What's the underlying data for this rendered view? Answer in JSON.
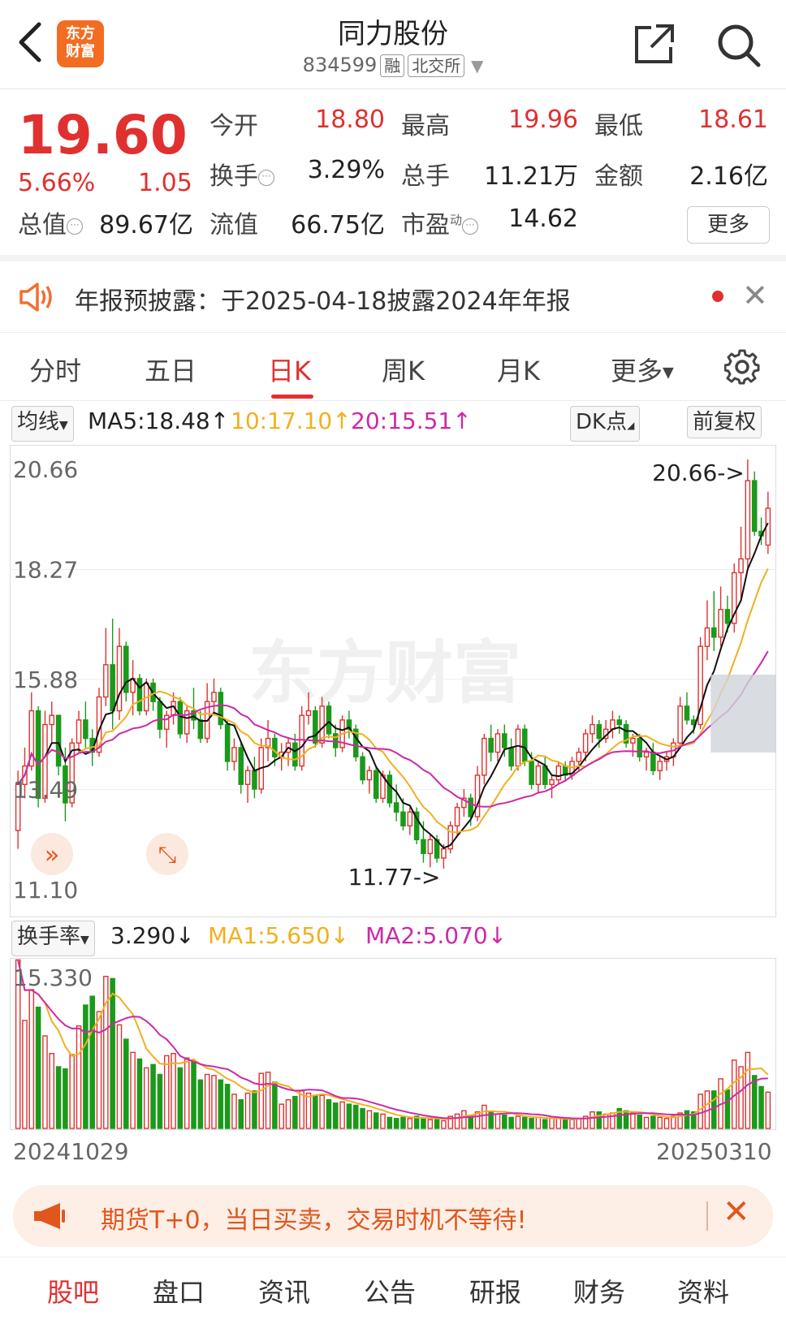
{
  "header": {
    "logo_line1": "东方",
    "logo_line2": "财富",
    "title": "同力股份",
    "code": "834599",
    "tag_margin": "融",
    "tag_exchange": "北交所"
  },
  "quote": {
    "price": "19.60",
    "pct": "5.66%",
    "change": "1.05",
    "stats": [
      {
        "label": "今开",
        "value": "18.80",
        "color": "#e03030"
      },
      {
        "label": "最高",
        "value": "19.96",
        "color": "#e03030"
      },
      {
        "label": "最低",
        "value": "18.61",
        "color": "#e03030"
      },
      {
        "label": "换手",
        "value": "3.29%",
        "color": "#222222"
      },
      {
        "label": "总手",
        "value": "11.21万",
        "color": "#222222"
      },
      {
        "label": "金额",
        "value": "2.16亿",
        "color": "#222222"
      },
      {
        "label": "总值",
        "value": "89.67亿",
        "color": "#222222"
      },
      {
        "label": "流值",
        "value": "66.75亿",
        "color": "#222222"
      },
      {
        "label": "市盈",
        "value": "14.62",
        "color": "#222222"
      }
    ],
    "pe_superscript": "动",
    "more_button": "更多"
  },
  "notice": {
    "text": "年报预披露：于2025-04-18披露2024年年报"
  },
  "tabs": [
    "分时",
    "五日",
    "日K",
    "周K",
    "月K",
    "更多"
  ],
  "active_tab": "日K",
  "ma_bar": {
    "selector": "均线",
    "ma5": "MA5:18.48",
    "ma10": "10:17.10",
    "ma20": "20:15.51",
    "dk": "DK点",
    "adjust": "前复权"
  },
  "chart_data": {
    "type": "candlestick",
    "ylim": [
      11.1,
      20.66
    ],
    "y_ticks": [
      "20.66",
      "18.27",
      "15.88",
      "13.49",
      "11.10"
    ],
    "annotations": {
      "high": "20.66->",
      "low": "11.77->"
    },
    "watermark": "东方财富",
    "x_start": "20241029",
    "x_end": "20250310",
    "candles": [
      [
        12.6,
        13.9,
        12.2,
        13.6
      ],
      [
        13.6,
        14.4,
        13.3,
        14.0
      ],
      [
        14.0,
        15.6,
        13.9,
        15.2
      ],
      [
        15.2,
        15.3,
        13.1,
        13.3
      ],
      [
        13.3,
        15.2,
        13.2,
        14.9
      ],
      [
        14.9,
        15.4,
        14.5,
        15.1
      ],
      [
        15.1,
        15.1,
        13.8,
        14.0
      ],
      [
        14.0,
        14.4,
        12.8,
        13.2
      ],
      [
        13.2,
        14.6,
        13.1,
        14.5
      ],
      [
        14.5,
        15.2,
        14.3,
        15.0
      ],
      [
        15.0,
        15.4,
        14.4,
        14.6
      ],
      [
        14.6,
        14.8,
        14.0,
        14.3
      ],
      [
        14.3,
        15.7,
        14.2,
        15.5
      ],
      [
        15.5,
        17.0,
        15.3,
        16.2
      ],
      [
        16.2,
        17.2,
        14.8,
        15.2
      ],
      [
        15.2,
        17.0,
        15.0,
        16.6
      ],
      [
        16.6,
        16.7,
        15.4,
        15.6
      ],
      [
        15.6,
        16.3,
        15.1,
        15.9
      ],
      [
        15.9,
        16.0,
        15.1,
        15.2
      ],
      [
        15.2,
        15.9,
        15.1,
        15.8
      ],
      [
        15.8,
        15.9,
        15.2,
        15.4
      ],
      [
        15.4,
        15.5,
        14.6,
        14.8
      ],
      [
        14.8,
        15.2,
        14.4,
        15.1
      ],
      [
        15.1,
        15.6,
        14.9,
        15.4
      ],
      [
        15.4,
        15.5,
        14.6,
        14.7
      ],
      [
        14.7,
        15.3,
        14.5,
        15.2
      ],
      [
        15.2,
        15.7,
        14.8,
        15.0
      ],
      [
        15.0,
        15.2,
        14.5,
        14.6
      ],
      [
        14.6,
        15.8,
        14.5,
        15.4
      ],
      [
        15.4,
        15.9,
        15.1,
        15.6
      ],
      [
        15.6,
        15.7,
        14.8,
        14.9
      ],
      [
        14.9,
        15.0,
        13.9,
        14.1
      ],
      [
        14.1,
        14.6,
        13.9,
        14.4
      ],
      [
        14.4,
        14.5,
        13.4,
        13.6
      ],
      [
        13.6,
        14.0,
        13.2,
        13.9
      ],
      [
        13.9,
        14.2,
        13.3,
        13.5
      ],
      [
        13.5,
        14.6,
        13.4,
        14.4
      ],
      [
        14.4,
        15.0,
        14.1,
        14.6
      ],
      [
        14.6,
        14.7,
        14.0,
        14.2
      ],
      [
        14.2,
        14.5,
        13.9,
        14.3
      ],
      [
        14.3,
        14.6,
        14.0,
        14.5
      ],
      [
        14.5,
        14.7,
        13.9,
        14.0
      ],
      [
        14.0,
        15.3,
        13.9,
        15.1
      ],
      [
        15.1,
        15.6,
        14.9,
        15.2
      ],
      [
        15.2,
        15.3,
        14.4,
        14.5
      ],
      [
        14.5,
        15.5,
        14.4,
        15.3
      ],
      [
        15.3,
        15.4,
        14.6,
        14.7
      ],
      [
        14.7,
        14.9,
        14.2,
        14.4
      ],
      [
        14.4,
        15.1,
        14.3,
        15.0
      ],
      [
        15.0,
        15.2,
        14.6,
        14.8
      ],
      [
        14.8,
        14.9,
        14.1,
        14.2
      ],
      [
        14.2,
        14.3,
        13.6,
        13.7
      ],
      [
        13.7,
        14.0,
        13.4,
        13.9
      ],
      [
        13.9,
        14.0,
        13.2,
        13.3
      ],
      [
        13.3,
        13.9,
        13.2,
        13.8
      ],
      [
        13.8,
        13.9,
        13.1,
        13.2
      ],
      [
        13.2,
        13.6,
        12.8,
        13.0
      ],
      [
        13.0,
        13.3,
        12.6,
        12.7
      ],
      [
        12.7,
        13.1,
        12.5,
        13.0
      ],
      [
        13.0,
        13.1,
        12.3,
        12.4
      ],
      [
        12.4,
        12.8,
        11.9,
        12.1
      ],
      [
        12.1,
        12.5,
        11.8,
        12.4
      ],
      [
        12.4,
        12.5,
        11.9,
        12.0
      ],
      [
        12.0,
        12.3,
        11.77,
        12.2
      ],
      [
        12.2,
        12.8,
        12.1,
        12.7
      ],
      [
        12.7,
        13.2,
        12.5,
        13.1
      ],
      [
        13.1,
        13.5,
        12.9,
        13.3
      ],
      [
        13.3,
        13.4,
        12.7,
        12.9
      ],
      [
        12.9,
        14.0,
        12.8,
        13.8
      ],
      [
        13.8,
        14.7,
        13.6,
        14.6
      ],
      [
        14.6,
        14.9,
        14.1,
        14.3
      ],
      [
        14.3,
        14.8,
        14.1,
        14.7
      ],
      [
        14.7,
        14.9,
        14.2,
        14.4
      ],
      [
        14.4,
        14.6,
        13.9,
        14.0
      ],
      [
        14.0,
        14.9,
        13.9,
        14.8
      ],
      [
        14.8,
        14.9,
        14.0,
        14.1
      ],
      [
        14.1,
        14.3,
        13.5,
        13.6
      ],
      [
        13.6,
        14.1,
        13.4,
        14.0
      ],
      [
        14.0,
        14.2,
        13.5,
        13.6
      ],
      [
        13.6,
        13.8,
        13.3,
        13.7
      ],
      [
        13.7,
        14.1,
        13.6,
        14.0
      ],
      [
        14.0,
        14.1,
        13.7,
        13.8
      ],
      [
        13.8,
        14.2,
        13.7,
        14.1
      ],
      [
        14.1,
        14.4,
        13.9,
        14.3
      ],
      [
        14.3,
        14.8,
        14.1,
        14.7
      ],
      [
        14.7,
        15.1,
        14.5,
        14.9
      ],
      [
        14.9,
        15.0,
        14.4,
        14.6
      ],
      [
        14.6,
        15.0,
        14.5,
        14.8
      ],
      [
        14.8,
        15.2,
        14.6,
        15.0
      ],
      [
        15.0,
        15.1,
        14.7,
        14.9
      ],
      [
        14.9,
        15.0,
        14.4,
        14.5
      ],
      [
        14.5,
        14.7,
        14.2,
        14.6
      ],
      [
        14.6,
        14.7,
        14.1,
        14.2
      ],
      [
        14.2,
        14.4,
        13.9,
        14.3
      ],
      [
        14.3,
        14.5,
        13.8,
        13.9
      ],
      [
        13.9,
        14.2,
        13.7,
        14.1
      ],
      [
        14.1,
        14.3,
        13.9,
        14.2
      ],
      [
        14.2,
        14.6,
        14.0,
        14.5
      ],
      [
        14.5,
        15.5,
        14.4,
        15.3
      ],
      [
        15.3,
        15.6,
        14.9,
        15.0
      ],
      [
        15.0,
        15.1,
        14.7,
        14.9
      ],
      [
        14.9,
        16.8,
        14.8,
        16.6
      ],
      [
        16.6,
        17.6,
        16.3,
        17.0
      ],
      [
        17.0,
        17.8,
        16.5,
        16.8
      ],
      [
        16.8,
        17.9,
        16.6,
        17.4
      ],
      [
        17.4,
        17.7,
        16.9,
        17.1
      ],
      [
        17.1,
        18.4,
        16.9,
        18.2
      ],
      [
        18.2,
        19.2,
        17.6,
        18.5
      ],
      [
        18.5,
        20.66,
        18.3,
        20.2
      ],
      [
        20.2,
        20.4,
        19.0,
        19.1
      ],
      [
        19.1,
        19.4,
        18.8,
        19.0
      ],
      [
        18.8,
        19.96,
        18.61,
        19.6
      ]
    ],
    "turnover": {
      "label": "换手率",
      "value": "3.290",
      "ma1": "MA1:5.650",
      "ma2": "MA2:5.070",
      "ylim": [
        0,
        15.33
      ],
      "y_top_tick": "15.330",
      "values": [
        15.3,
        9.8,
        12.6,
        11.0,
        8.4,
        6.8,
        5.6,
        5.4,
        6.7,
        9.3,
        11.2,
        12.0,
        10.6,
        13.8,
        13.6,
        9.4,
        8.1,
        6.9,
        6.3,
        5.5,
        5.8,
        4.9,
        6.6,
        6.8,
        5.5,
        6.4,
        6.1,
        4.4,
        4.9,
        4.8,
        4.4,
        4.0,
        3.1,
        2.6,
        3.2,
        3.4,
        5.0,
        5.1,
        4.2,
        2.2,
        2.6,
        2.9,
        3.4,
        3.2,
        3.0,
        3.0,
        2.6,
        2.3,
        2.4,
        2.2,
        2.1,
        1.8,
        1.6,
        1.4,
        1.3,
        1.0,
        0.9,
        1.0,
        0.9,
        1.1,
        0.9,
        0.8,
        0.8,
        0.7,
        1.1,
        1.3,
        1.6,
        1.2,
        1.5,
        2.1,
        1.5,
        1.3,
        1.2,
        1.0,
        1.1,
        1.0,
        0.9,
        1.0,
        0.8,
        0.9,
        0.9,
        0.8,
        0.8,
        0.9,
        1.1,
        1.5,
        1.5,
        1.3,
        1.4,
        1.8,
        1.6,
        1.4,
        1.2,
        1.0,
        1.1,
        1.0,
        0.9,
        1.1,
        1.4,
        1.6,
        1.5,
        3.1,
        3.4,
        3.4,
        4.5,
        3.5,
        6.2,
        5.6,
        6.9,
        4.8,
        3.8,
        3.29
      ]
    }
  },
  "promo": {
    "text": "期货T+0，当日买卖，交易时机不等待!"
  },
  "bottom_nav": [
    "股吧",
    "盘口",
    "资讯",
    "公告",
    "研报",
    "财务",
    "资料"
  ],
  "colors": {
    "up": "#e03030",
    "down": "#1a9a1a",
    "ma5": "#111111",
    "ma10": "#f0b020",
    "ma20": "#cc2aa6",
    "accent": "#e03030"
  }
}
